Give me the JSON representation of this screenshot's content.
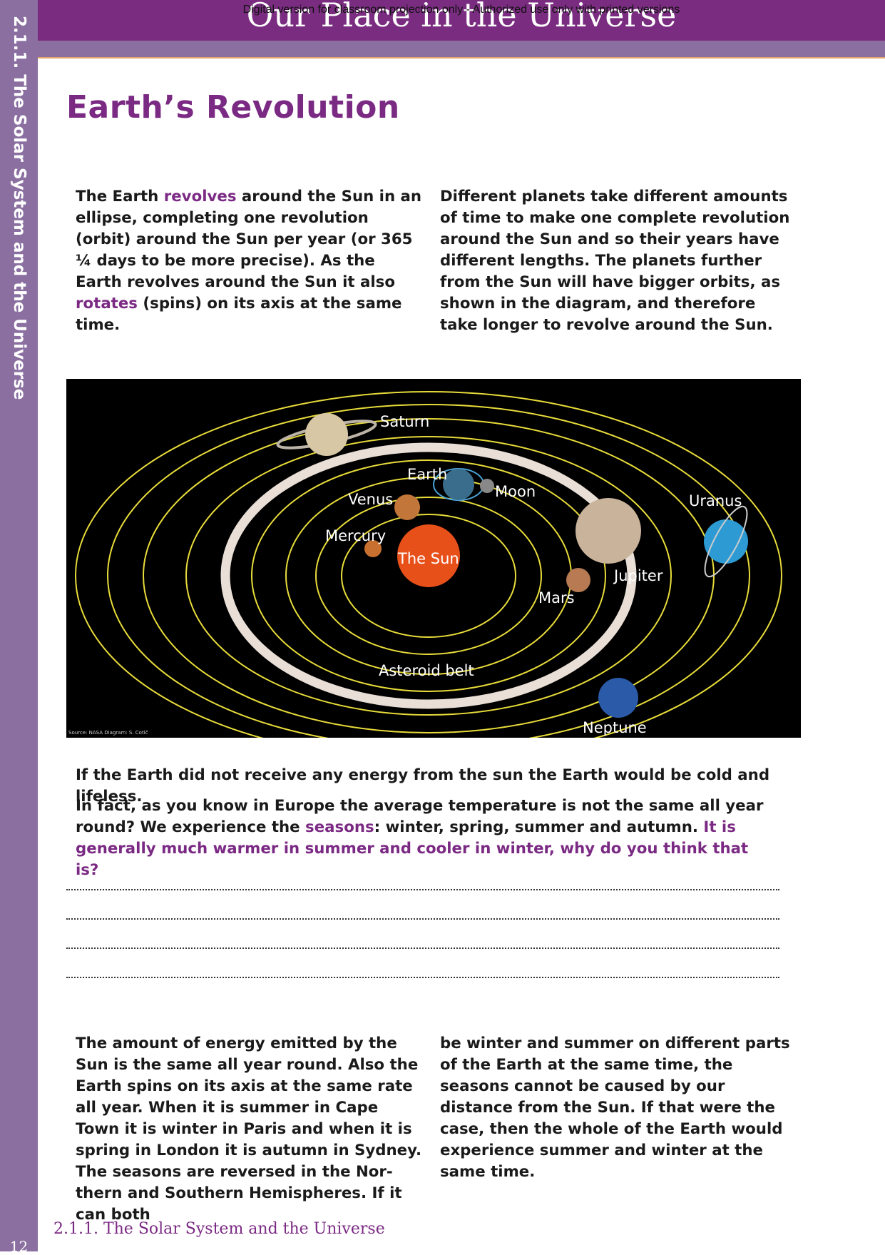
{
  "header": {
    "watermark": "Digital version for classroom projection only - Authorized use only with printed versions",
    "title": "Our Place in the Universe"
  },
  "sidebar": {
    "section": "2.1.1. The Solar System and the Universe"
  },
  "page_title": "Earth’s Revolution",
  "intro_left": {
    "t1": "The Earth ",
    "k1": "revolves",
    "t2": " around the Sun in an el­lipse, completing one revolution (orbit) around the Sun per year (or 365 ¼ days to be more precise). As the Earth revolves around the Sun it also ",
    "k2": "rotates",
    "t3": " (spins) on its axis at the same time."
  },
  "intro_right": "Different planets take different amounts of time to make one complete revolution around the Sun and so their years have different lengths. The planets further from the Sun will have bigger orbits, as shown in the diagram, and therefore take longer to revolve around the Sun.",
  "diagram": {
    "labels": {
      "saturn": "Saturn",
      "earth": "Earth",
      "moon": "Moon",
      "venus": "Venus",
      "mercury": "Mercury",
      "sun": "The Sun",
      "mars": "Mars",
      "jupiter": "Jupiter",
      "uranus": "Uranus",
      "asteroid_belt": "Asteroid belt",
      "neptune": "Neptune"
    },
    "credit": "Source: NASA Diagram: S. Cotič",
    "colors": {
      "orbit": "#e8dc3a",
      "sun": "#e8501a",
      "background": "#000000"
    }
  },
  "energy_text": "If the Earth did not receive any energy from the sun the Earth would be cold and lifeless.",
  "seasons": {
    "t1": "In fact, as you know in Europe the average temperature is not the same all year round? We experience the ",
    "k1": "seasons",
    "t2": ": winter, spring, summer and autumn. ",
    "question": "It is generally much warmer in summer and cooler in winter, why do you think that is?"
  },
  "bottom_left": "The amount of energy emitted by the Sun is the same all year round. Also the Earth spins on its axis at the same rate all year. When it is summer in Cape Town it is winter in Paris and when it is spring in London it is autumn in Sydney. The seasons are reversed in the Nor­thern and Southern Hemispheres. If it can both",
  "bottom_right": "be winter and summer on different parts of the Earth at the same time, the seasons cannot be caused by our distance from the Sun. If that were the case, then the whole of the Earth would experience summer and winter at the same time.",
  "footer": {
    "page_number": "12",
    "section": "2.1.1. The Solar System and the Universe"
  }
}
